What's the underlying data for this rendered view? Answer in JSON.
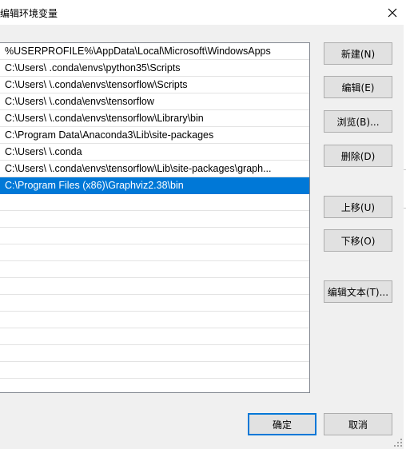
{
  "window": {
    "title": "编辑环境变量"
  },
  "path_list": {
    "items": [
      "%USERPROFILE%\\AppData\\Local\\Microsoft\\WindowsApps",
      "C:\\Users\\ .conda\\envs\\python35\\Scripts",
      "C:\\Users\\ \\.conda\\envs\\tensorflow\\Scripts",
      "C:\\Users\\ \\.conda\\envs\\tensorflow",
      "C:\\Users\\ \\.conda\\envs\\tensorflow\\Library\\bin",
      "C:\\Program Data\\Anaconda3\\Lib\\site-packages",
      "C:\\Users\\ \\.conda",
      "C:\\Users\\ \\.conda\\envs\\tensorflow\\Lib\\site-packages\\graph...",
      "C:\\Program Files (x86)\\Graphviz2.38\\bin"
    ],
    "selected_index": 8
  },
  "buttons": {
    "new": "新建(N)",
    "edit": "编辑(E)",
    "browse": "浏览(B)...",
    "delete": "删除(D)",
    "move_up": "上移(U)",
    "move_down": "下移(O)",
    "edit_text": "编辑文本(T)...",
    "ok": "确定",
    "cancel": "取消"
  },
  "colors": {
    "selection": "#0078d7",
    "dialog_bg": "#f0f0f0",
    "button_bg": "#e1e1e1"
  }
}
